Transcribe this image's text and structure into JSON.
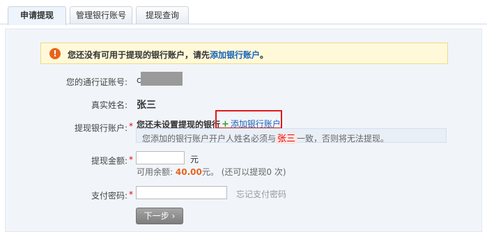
{
  "tabs": [
    {
      "label": "申请提现"
    },
    {
      "label": "管理银行账号"
    },
    {
      "label": "提现查询"
    }
  ],
  "alert": {
    "icon": "exclamation-icon",
    "text_before": "您还没有可用于提现的银行账户，请先",
    "link": "添加银行账户",
    "text_after": "。"
  },
  "form": {
    "account_label": "您的通行证账号:",
    "account_prefix": "ch",
    "realname_label": "真实姓名:",
    "realname_value": "张三",
    "bank_label": "提现银行账户:",
    "bank_status": "您还未设置提现的银行",
    "add_bank_link": "添加银行账户",
    "hint_before": "您添加的银行账户开户人姓名必须与",
    "hint_name": "张三",
    "hint_after": "一致，否则将无法提现。",
    "amount_label": "提现金额:",
    "amount_value": "",
    "amount_unit": "元",
    "balance_before": "可用余额:",
    "balance_value": "40.00",
    "balance_unit": "元。",
    "balance_after": "(还可以提现0 次)",
    "password_label": "支付密码:",
    "password_value": "",
    "forgot_password": "忘记支付密码",
    "next_button": "下一步"
  },
  "colors": {
    "link": "#1a62b9",
    "required": "#e60012",
    "amount": "#e8641b",
    "alert_bg": "#fff9d9"
  }
}
